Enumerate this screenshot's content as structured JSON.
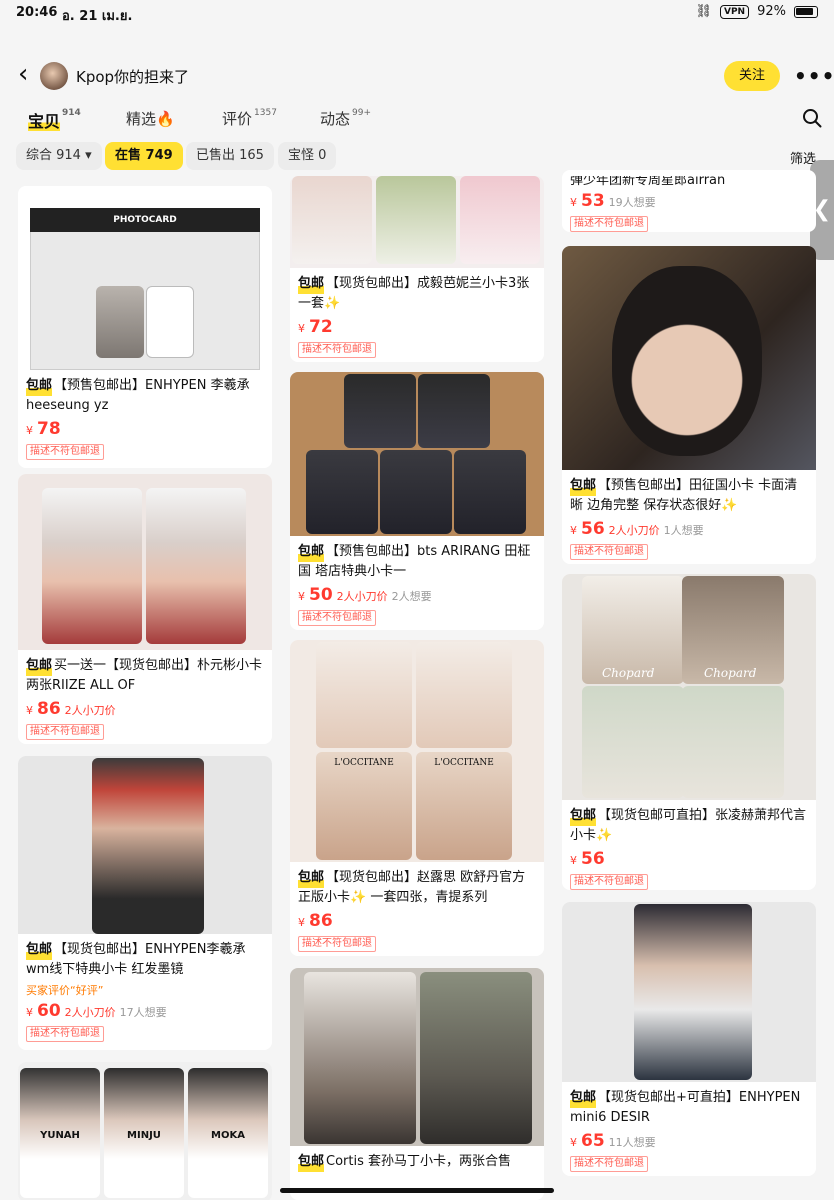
{
  "status_bar": {
    "time": "20:46",
    "date": "อ. 21 เม.ย.",
    "vpn": "VPN",
    "battery": "92%"
  },
  "header": {
    "back_icon": "chevron-left-icon",
    "title": "Kpop你的担来了",
    "follow_label": "关注",
    "more_icon": "more-icon"
  },
  "tabs": [
    {
      "label": "宝贝",
      "count": "914"
    },
    {
      "label": "精选",
      "icon": "fire-icon"
    },
    {
      "label": "评价",
      "count": "1357"
    },
    {
      "label": "动态",
      "count": "99+"
    }
  ],
  "filters": [
    {
      "label": "综合 914 ▾"
    },
    {
      "label": "在售 749"
    },
    {
      "label": "已售出 165"
    },
    {
      "label": "宝怪 0"
    }
  ],
  "filter_button": "筛选",
  "side_handle": "❮",
  "colors": {
    "accent": "#ffe033",
    "price": "#ff3a2f",
    "review": "#ff7a00"
  },
  "products": [
    {
      "tag": "包邮",
      "title": "【预售包邮出】ENHYPEN 李羲承 heeseung yz",
      "price": "78",
      "notice": "描述不符包邮退",
      "img_label": "PHOTOCARD"
    },
    {
      "tag": "包邮",
      "title": "买一送一【现货包邮出】朴元彬小卡两张RIIZE ALL OF",
      "price": "86",
      "bargain": "2人小刀价",
      "notice": "描述不符包邮退"
    },
    {
      "tag": "包邮",
      "title": "【现货包邮出】ENHYPEN李羲承wm线下特典小卡 红发墨镜",
      "review": "买家评价“好评”",
      "price": "60",
      "bargain": "2人小刀价",
      "want": "17人想要",
      "notice": "描述不符包邮退"
    },
    {
      "title": "",
      "img_labels": [
        "YUNAH",
        "MINJU",
        "MOKA"
      ]
    },
    {
      "tag": "包邮",
      "title": "【现货包邮出】成毅芭妮兰小卡3张一套✨",
      "price": "72",
      "notice": "描述不符包邮退"
    },
    {
      "tag": "包邮",
      "title": "【预售包邮出】bts ARIRANG 田柾国 塔店特典小卡一",
      "price": "50",
      "bargain": "2人小刀价",
      "want": "2人想要",
      "notice": "描述不符包邮退"
    },
    {
      "tag": "包邮",
      "title": "【现货包邮出】赵露思 欧舒丹官方正版小卡✨ 一套四张，青提系列",
      "price": "86",
      "notice": "描述不符包邮退",
      "img_label": "L'OCCITANE"
    },
    {
      "tag": "包邮",
      "title": "Cortis 套孙马丁小卡，两张合售"
    },
    {
      "title": "弹少年团新专周星郎airran",
      "price": "53",
      "want": "19人想要",
      "notice": "描述不符包邮退"
    },
    {
      "tag": "包邮",
      "title": "【预售包邮出】田征国小卡 卡面清晰 边角完整 保存状态很好✨",
      "price": "56",
      "bargain": "2人小刀价",
      "want": "1人想要",
      "notice": "描述不符包邮退"
    },
    {
      "tag": "包邮",
      "title": "【现货包邮可直拍】张凌赫萧邦代言小卡✨",
      "price": "56",
      "notice": "描述不符包邮退",
      "img_label": "Chopard"
    },
    {
      "tag": "包邮",
      "title": "【现货包邮出+可直拍】ENHYPEN mini6 DESIR",
      "price": "65",
      "want": "11人想要",
      "notice": "描述不符包邮退"
    }
  ],
  "currency": "¥"
}
